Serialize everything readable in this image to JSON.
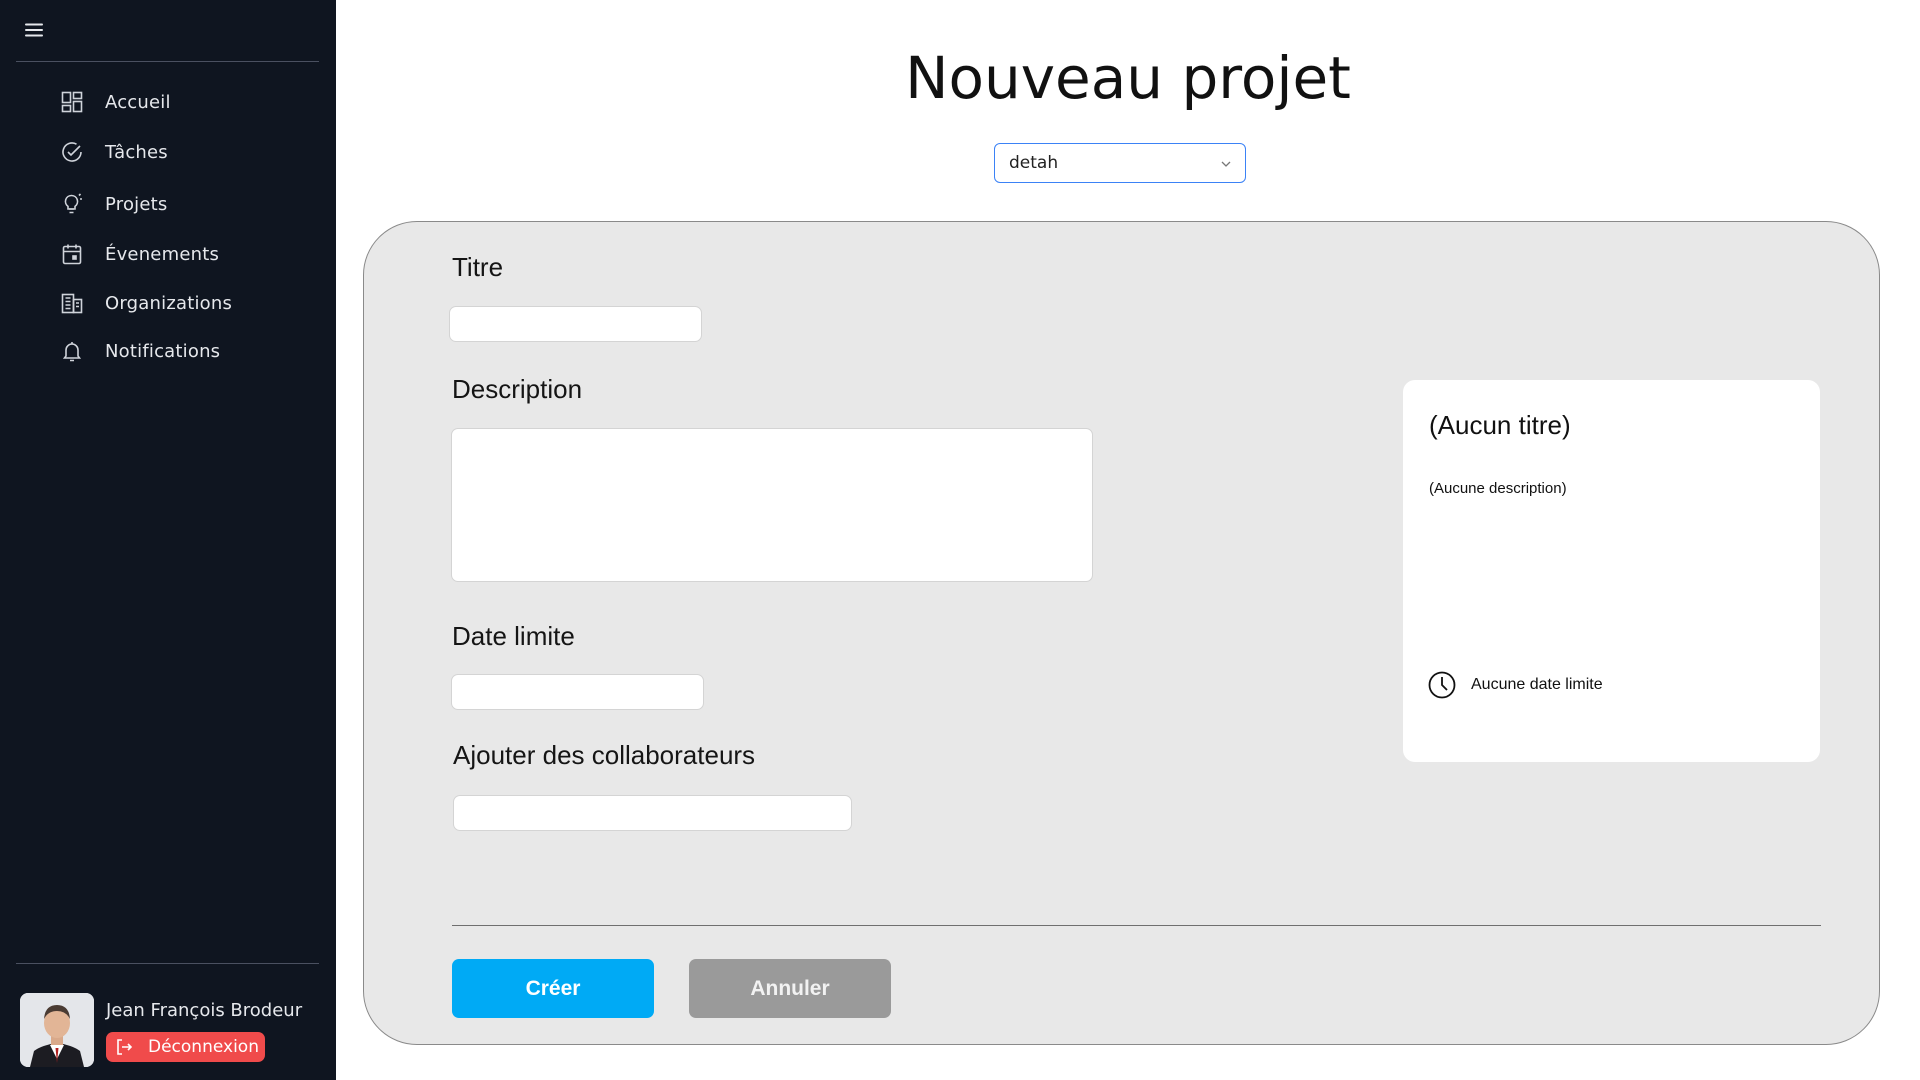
{
  "sidebar": {
    "menu_icon": "hamburger-menu-icon",
    "items": [
      {
        "label": "Accueil",
        "icon": "dashboard-grid-icon"
      },
      {
        "label": "Tâches",
        "icon": "check-circle-icon"
      },
      {
        "label": "Projets",
        "icon": "lightbulb-icon"
      },
      {
        "label": "Évenements",
        "icon": "calendar-icon"
      },
      {
        "label": "Organizations",
        "icon": "building-icon"
      },
      {
        "label": "Notifications",
        "icon": "bell-icon"
      }
    ],
    "user": {
      "name": "Jean François Brodeur",
      "logout_label": "Déconnexion"
    }
  },
  "main": {
    "title": "Nouveau projet",
    "organization_select": {
      "value": "detah"
    }
  },
  "form": {
    "title_label": "Titre",
    "title_value": "",
    "description_label": "Description",
    "description_value": "",
    "deadline_label": "Date limite",
    "deadline_value": "",
    "collaborators_label": "Ajouter des collaborateurs",
    "collaborators_value": "",
    "create_label": "Créer",
    "cancel_label": "Annuler"
  },
  "preview": {
    "title": "(Aucun titre)",
    "description": "(Aucune description)",
    "deadline": "Aucune date limite"
  },
  "colors": {
    "sidebar_bg": "#0f1520",
    "accent": "#00aaf5",
    "logout": "#f04b4b",
    "cancel": "#9a9a9a",
    "card_bg": "#e8e8e8",
    "select_border": "#3b82f6"
  }
}
